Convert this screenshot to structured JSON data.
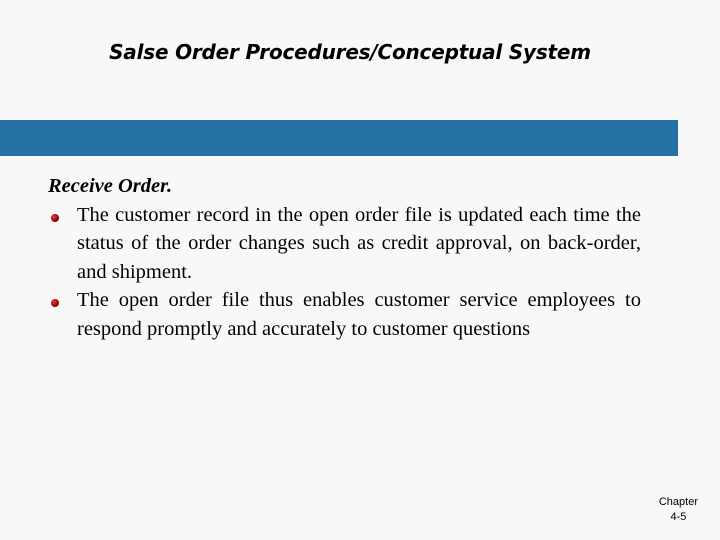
{
  "slide": {
    "title": "Salse Order Procedures/Conceptual System",
    "accent_color": "#2570a5",
    "bullet_color": "#a00000",
    "heading": "Receive Order.",
    "bullets": [
      "The customer record in the open order file is updated each time the status of the order changes such as credit approval, on back-order, and shipment.",
      "The open order file thus enables customer service employees to respond promptly and accurately to customer questions"
    ],
    "footer": {
      "line1": "Chapter",
      "line2": "4-5"
    }
  }
}
